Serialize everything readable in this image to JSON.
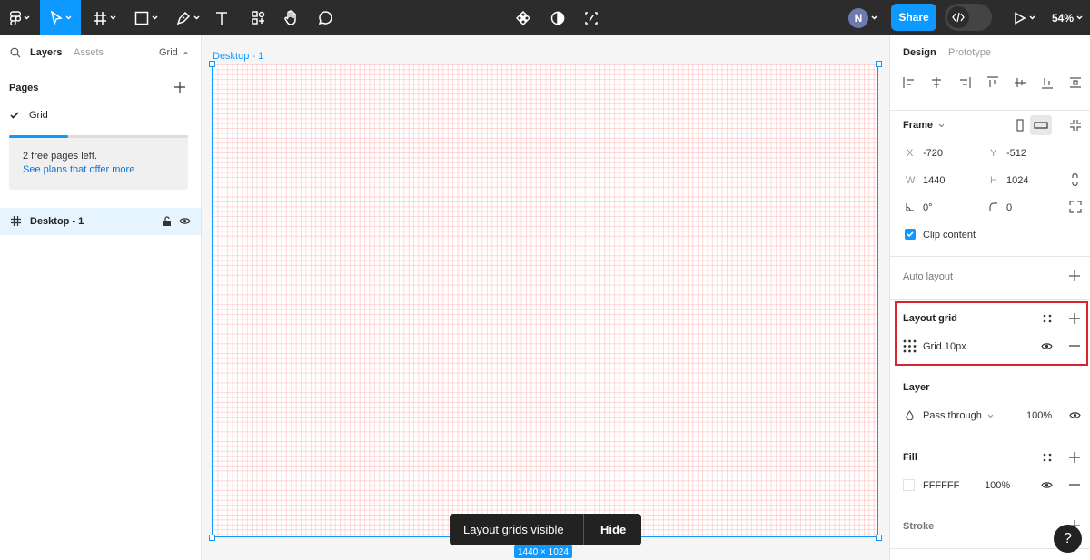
{
  "toolbar": {
    "share_label": "Share",
    "avatar_initial": "N",
    "zoom": "54%"
  },
  "left_panel": {
    "tab_layers": "Layers",
    "tab_assets": "Assets",
    "page_dropdown": "Grid",
    "pages_heading": "Pages",
    "current_page": "Grid",
    "banner_text": "2 free pages left.",
    "banner_link": "See plans that offer more",
    "banner_progress": 0.33,
    "layer_name": "Desktop - 1"
  },
  "canvas": {
    "frame_label": "Desktop - 1",
    "frame_size": "1440 × 1024",
    "toast_text": "Layout grids visible",
    "toast_action": "Hide"
  },
  "right_panel": {
    "tab_design": "Design",
    "tab_prototype": "Prototype",
    "frame": {
      "heading": "Frame",
      "x_label": "X",
      "x": "-720",
      "y_label": "Y",
      "y": "-512",
      "w_label": "W",
      "w": "1440",
      "h_label": "H",
      "h": "1024",
      "rotation": "0°",
      "radius": "0",
      "clip_label": "Clip content"
    },
    "auto_layout": "Auto layout",
    "layout_grid": {
      "heading": "Layout grid",
      "item": "Grid 10px"
    },
    "layer": {
      "heading": "Layer",
      "blend": "Pass through",
      "opacity": "100%"
    },
    "fill": {
      "heading": "Fill",
      "hex": "FFFFFF",
      "opacity": "100%"
    },
    "stroke": "Stroke"
  },
  "help_label": "?",
  "colors": {
    "accent": "#0d99ff",
    "toolbar": "#2c2c2c",
    "highlight_box": "#d9242e",
    "grid_line": "#ff7878"
  }
}
